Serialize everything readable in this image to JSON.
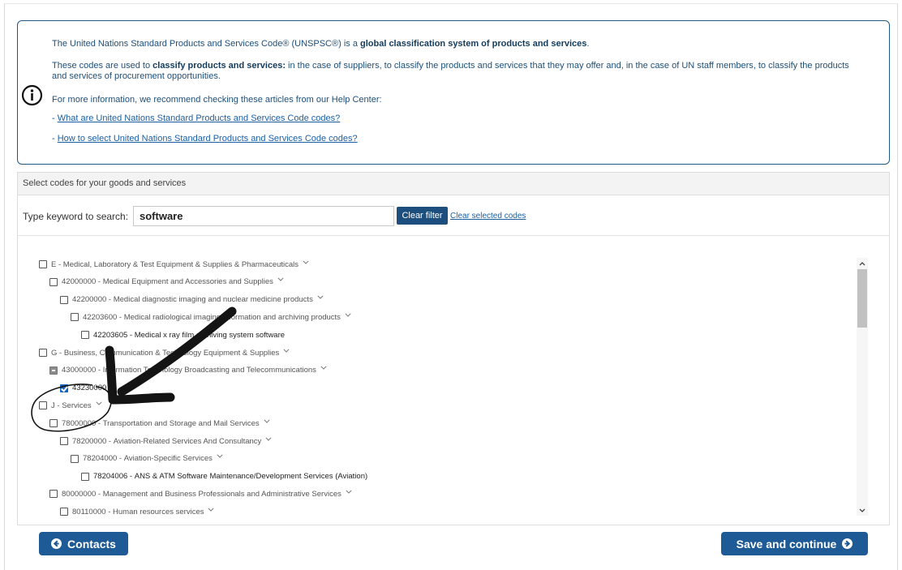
{
  "info": {
    "p1_pre": "The United Nations Standard Products and Services Code® (UNSPSC®) is a ",
    "p1_bold": "global classification system of products and services",
    "p1_post": ".",
    "p2_pre": "These codes are used to ",
    "p2_bold": "classify products and services:",
    "p2_post": " in the case of suppliers, to classify the products and services that they may offer and, in the case of UN staff members, to classify the products and services of procurement opportunities.",
    "p3": "For more information, we recommend checking these articles from our Help Center:",
    "link_prefix": "- ",
    "link1": "What are United Nations Standard Products and Services Code codes?",
    "link2": "How to select United Nations Standard Products and Services Code codes?",
    "icon": "info-circle-icon"
  },
  "panel": {
    "header": "Select codes for your goods and services",
    "search_label": "Type keyword to search:",
    "search_value": "software",
    "clear_filter": "Clear filter",
    "clear_selected": "Clear selected codes"
  },
  "tree": [
    {
      "code": "E",
      "label": "Medical, Laboratory & Test Equipment & Supplies & Pharmaceuticals",
      "state": "unchecked",
      "expandable": true
    },
    {
      "code": "42000000",
      "label": "Medical Equipment and Accessories and Supplies",
      "state": "unchecked",
      "expandable": true
    },
    {
      "code": "42200000",
      "label": "Medical diagnostic imaging and nuclear medicine products",
      "state": "unchecked",
      "expandable": true
    },
    {
      "code": "42203600",
      "label": "Medical radiological imaging information and archiving products",
      "state": "unchecked",
      "expandable": true
    },
    {
      "code": "42203605",
      "label": "Medical x ray film archiving system software",
      "state": "unchecked",
      "expandable": false
    },
    {
      "code": "G",
      "label": "Business, Communication & Technology Equipment & Supplies",
      "state": "unchecked",
      "expandable": true
    },
    {
      "code": "43000000",
      "label": "Information Technology Broadcasting and Telecommunications",
      "state": "partial",
      "expandable": true
    },
    {
      "code": "43230000",
      "label": "",
      "state": "checked",
      "expandable": false
    },
    {
      "code": "J",
      "label": "Services",
      "state": "unchecked",
      "expandable": true
    },
    {
      "code": "78000000",
      "label": "Transportation and Storage and Mail Services",
      "state": "unchecked",
      "expandable": true
    },
    {
      "code": "78200000",
      "label": "Aviation-Related Services And Consultancy",
      "state": "unchecked",
      "expandable": true
    },
    {
      "code": "78204000",
      "label": "Aviation-Specific Services",
      "state": "unchecked",
      "expandable": true
    },
    {
      "code": "78204006",
      "label": "ANS & ATM Software Maintenance/Development Services (Aviation)",
      "state": "unchecked",
      "expandable": false
    },
    {
      "code": "80000000",
      "label": "Management and Business Professionals and Administrative Services",
      "state": "unchecked",
      "expandable": true
    },
    {
      "code": "80110000",
      "label": "Human resources services",
      "state": "unchecked",
      "expandable": true
    }
  ],
  "buttons": {
    "contacts": "Contacts",
    "contacts_icon": "circle-arrow-left-icon",
    "save": "Save and continue",
    "save_icon": "circle-arrow-right-icon"
  },
  "colors": {
    "accent": "#1e5a96",
    "info_border": "#1d5a8c",
    "link": "#1a5fa3"
  }
}
